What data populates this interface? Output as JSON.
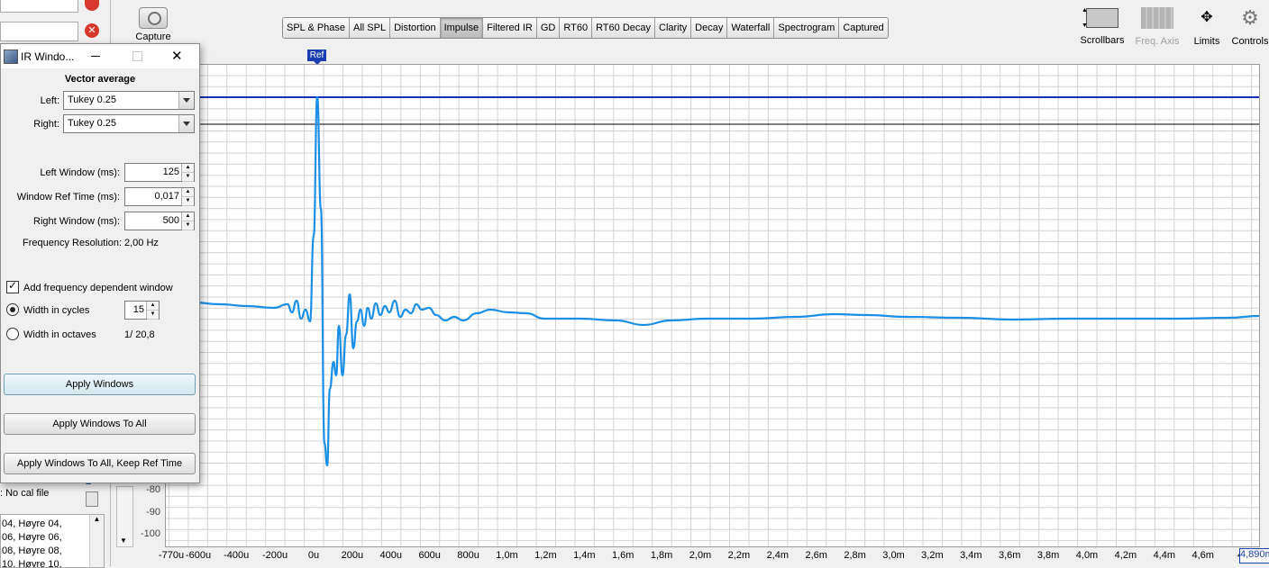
{
  "toolbar": {
    "capture_label": "Capture",
    "tabs": [
      {
        "label": "SPL & Phase"
      },
      {
        "label": "All SPL"
      },
      {
        "label": "Distortion"
      },
      {
        "label": "Impulse",
        "active": true
      },
      {
        "label": "Filtered IR"
      },
      {
        "label": "GD"
      },
      {
        "label": "RT60"
      },
      {
        "label": "RT60 Decay"
      },
      {
        "label": "Clarity"
      },
      {
        "label": "Decay"
      },
      {
        "label": "Waterfall"
      },
      {
        "label": "Spectrogram"
      },
      {
        "label": "Captured"
      }
    ],
    "tools": {
      "scrollbars": "Scrollbars",
      "freq_axis": "Freq. Axis",
      "limits": "Limits",
      "controls": "Controls"
    }
  },
  "graph": {
    "ref_marker": "Ref",
    "cursor_readout": "4,890m",
    "x_ticks": [
      "-770u",
      "-600u",
      "-400u",
      "-200u",
      "0u",
      "200u",
      "400u",
      "600u",
      "800u",
      "1,0m",
      "1,2m",
      "1,4m",
      "1,6m",
      "1,8m",
      "2,0m",
      "2,2m",
      "2,4m",
      "2,6m",
      "2,8m",
      "3,0m",
      "3,2m",
      "3,4m",
      "3,6m",
      "3,8m",
      "4,0m",
      "4,2m",
      "4,4m",
      "4,6m",
      "4,"
    ],
    "y_ticks": [
      "-80",
      "-90",
      "-100"
    ],
    "line_color": "#1a8fe6"
  },
  "sidebar": {
    "cal_line_1": "No cal file",
    "cal_line_2": ": No cal file",
    "list_items": [
      "04, Høyre 04,",
      "06, Høyre 06,",
      "08, Høyre 08,",
      "10, Høyre 10,"
    ]
  },
  "dialog": {
    "title": "IR Windo...",
    "heading": "Vector average",
    "left_label": "Left:",
    "left_value": "Tukey 0.25",
    "right_label": "Right:",
    "right_value": "Tukey 0.25",
    "left_window_label": "Left Window (ms):",
    "left_window_value": "125",
    "window_ref_label": "Window Ref Time (ms):",
    "window_ref_value": "0,017",
    "right_window_label": "Right Window (ms):",
    "right_window_value": "500",
    "freq_res_label": "Frequency Resolution:",
    "freq_res_value": "2,00 Hz",
    "fdw_label": "Add frequency dependent window",
    "cycles_label": "Width in cycles",
    "cycles_value": "15",
    "octaves_label": "Width in octaves",
    "octaves_value": "1/ 20,8",
    "apply": "Apply Windows",
    "apply_all": "Apply Windows To All",
    "apply_all_keep": "Apply Windows To All, Keep Ref Time"
  }
}
